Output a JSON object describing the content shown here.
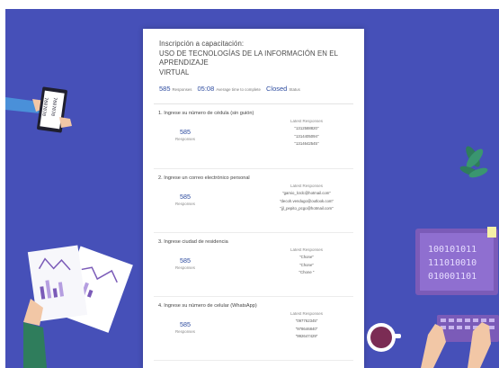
{
  "form": {
    "title_lines": [
      "Inscripción a capacitación:",
      "USO DE TECNOLOGÍAS DE LA INFORMACIÓN EN EL APRENDIZAJE",
      "VIRTUAL"
    ],
    "responses_count": "585",
    "responses_caption": "Responses",
    "avg_time": "05:08",
    "avg_time_caption": "Average time to complete",
    "status": "Closed",
    "status_caption": "Status"
  },
  "questions": [
    {
      "title": "1.  Ingrese su número de cédula (sin guión)",
      "count": "585",
      "count_caption": "Responses",
      "latest_header": "Latest Responses",
      "latest": [
        "\"1312588820\"",
        "\"1314405094\"",
        "\"1314642545\""
      ]
    },
    {
      "title": "2.  Ingrese un correo electrónico personal",
      "count": "585",
      "count_caption": "Responses",
      "latest_header": "Latest Responses",
      "latest": [
        "\"gamio_lcrdc@hotmail.com\"",
        "\"decoh.vendugo@outlook.com\"",
        "\"jjl_pepito_pcgo@hotmail.com\""
      ]
    },
    {
      "title": "3.  Ingrese ciudad de residencia",
      "count": "585",
      "count_caption": "Responses",
      "latest_header": "Latest Responses",
      "latest": [
        "\"Chone\"",
        "\"Chone\"",
        "\"Chone \""
      ]
    },
    {
      "title": "4.  Ingrese su número de celular (WhatsApp)",
      "count": "585",
      "count_caption": "Responses",
      "latest_header": "Latest Responses",
      "latest": [
        "\"097762345\"",
        "\"978646840\"",
        "\"992647429\""
      ]
    }
  ],
  "illustration": {
    "tablet_text": [
      "7007070",
      "7007070"
    ],
    "monitor_text": [
      "100101011",
      "111010010",
      "010001101"
    ],
    "colors": {
      "background": "#4650b8",
      "accent_blue": "#2f4da0",
      "monitor": "#7b5bb8",
      "sleeve": "#4a90d9",
      "plant": "#2f7d5c"
    }
  }
}
